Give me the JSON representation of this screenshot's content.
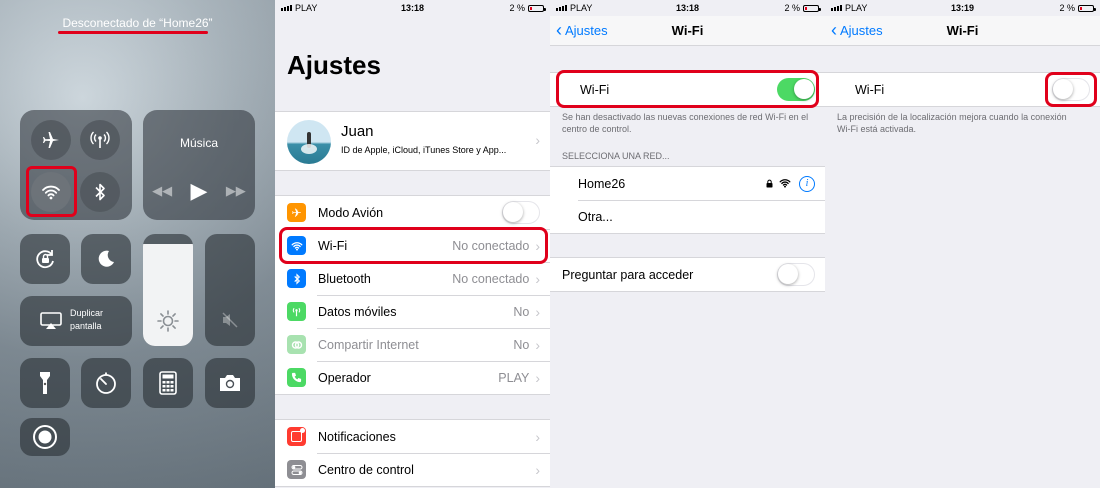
{
  "control_center": {
    "status": "Desconectado de “Home26”",
    "music_title": "Música",
    "mirror_label_1": "Duplicar",
    "mirror_label_2": "pantalla"
  },
  "status_bars": [
    {
      "carrier": "PLAY",
      "time": "13:18",
      "battery": "2 %"
    },
    {
      "carrier": "PLAY",
      "time": "13:18",
      "battery": "2 %"
    },
    {
      "carrier": "PLAY",
      "time": "13:19",
      "battery": "2 %"
    }
  ],
  "settings": {
    "title": "Ajustes",
    "profile_name": "Juan",
    "profile_sub": "ID de Apple, iCloud, iTunes Store y App...",
    "rows": [
      {
        "label": "Modo Avión",
        "value": ""
      },
      {
        "label": "Wi-Fi",
        "value": "No conectado"
      },
      {
        "label": "Bluetooth",
        "value": "No conectado"
      },
      {
        "label": "Datos móviles",
        "value": "No"
      },
      {
        "label": "Compartir Internet",
        "value": "No"
      },
      {
        "label": "Operador",
        "value": "PLAY"
      }
    ],
    "rows2": [
      {
        "label": "Notificaciones"
      },
      {
        "label": "Centro de control"
      }
    ]
  },
  "wifi_on": {
    "back": "Ajustes",
    "title": "Wi-Fi",
    "wifi_label": "Wi-Fi",
    "note": "Se han desactivado las nuevas conexiones de red Wi-Fi en el centro de control.",
    "section": "SELECCIONA UNA RED...",
    "networks": [
      "Home26",
      "Otra..."
    ],
    "ask_label": "Preguntar para acceder"
  },
  "wifi_off": {
    "back": "Ajustes",
    "title": "Wi-Fi",
    "wifi_label": "Wi-Fi",
    "note": "La precisión de la localización mejora cuando la conexión Wi-Fi está activada."
  },
  "colors": {
    "accent": "#007aff",
    "toggle_on": "#4cd964",
    "highlight": "#e0001b"
  }
}
